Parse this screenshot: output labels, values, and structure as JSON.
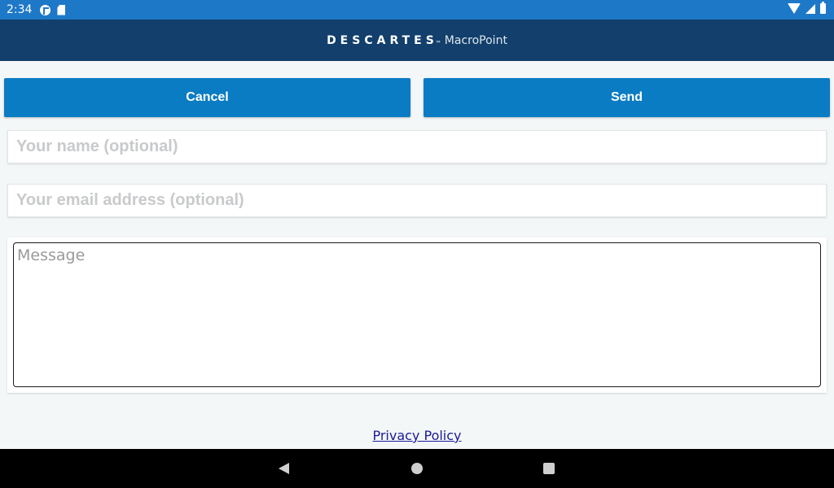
{
  "status_bar": {
    "time": "2:34",
    "icons": [
      "app-notification-icon",
      "sd-card-icon",
      "wifi-icon",
      "signal-icon",
      "battery-icon"
    ]
  },
  "header": {
    "brand": "DESCARTES",
    "brand_mark": "™",
    "product": "MacroPoint",
    "background": "#123f6b"
  },
  "actions": {
    "cancel_label": "Cancel",
    "send_label": "Send",
    "button_color": "#0a7cc3"
  },
  "form": {
    "name_placeholder": "Your name (optional)",
    "name_value": "",
    "email_placeholder": "Your email address (optional)",
    "email_value": "",
    "message_placeholder": "Message",
    "message_value": ""
  },
  "footer": {
    "privacy_link": "Privacy Policy"
  },
  "nav": {
    "icons": [
      "back-icon",
      "home-icon",
      "recents-icon"
    ]
  }
}
